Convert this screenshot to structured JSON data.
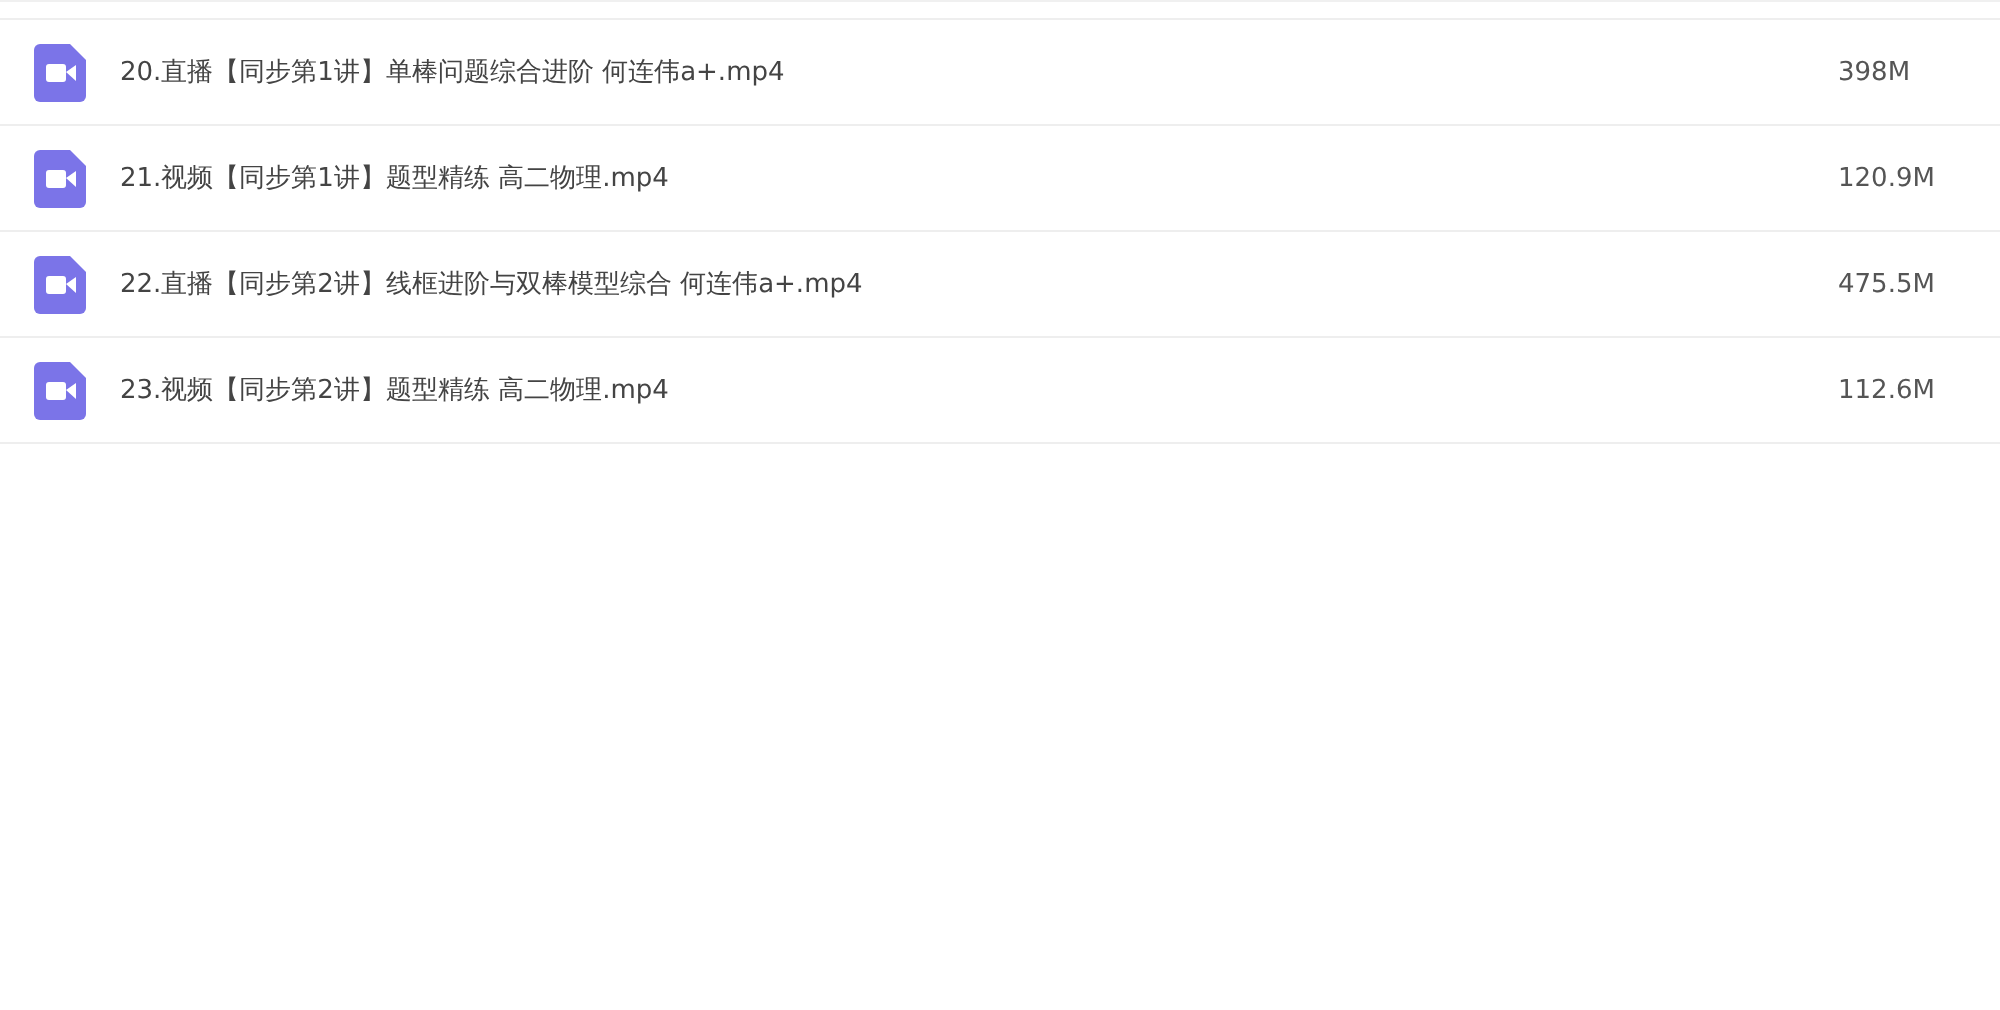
{
  "files": [
    {
      "name": "20.直播【同步第1讲】单棒问题综合进阶 何连伟a+.mp4",
      "size": "398M"
    },
    {
      "name": "21.视频【同步第1讲】题型精练 高二物理.mp4",
      "size": "120.9M"
    },
    {
      "name": "22.直播【同步第2讲】线框进阶与双棒模型综合 何连伟a+.mp4",
      "size": "475.5M"
    },
    {
      "name": "23.视频【同步第2讲】题型精练 高二物理.mp4",
      "size": "112.6M"
    }
  ]
}
